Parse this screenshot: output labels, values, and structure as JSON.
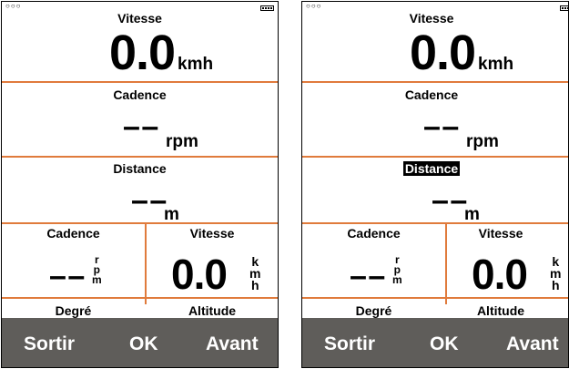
{
  "left": {
    "status": {
      "dots": "○○○"
    },
    "speed": {
      "label": "Vitesse",
      "value": "0.0",
      "unit": "kmh"
    },
    "cadence": {
      "label": "Cadence",
      "value": "– –",
      "unit": "rpm"
    },
    "distance": {
      "label": "Distance",
      "value": "– –",
      "unit": "m"
    },
    "grid": {
      "cadence": {
        "label": "Cadence",
        "value": "– –",
        "unit_letters": [
          "r",
          "p",
          "m"
        ]
      },
      "speed": {
        "label": "Vitesse",
        "value": "0.0",
        "unit_letters": [
          "k",
          "m",
          "h"
        ]
      },
      "degree_label": "Degré",
      "altitude_label": "Altitude"
    },
    "softkeys": {
      "left": "Sortir",
      "center": "OK",
      "right": "Avant"
    }
  },
  "right": {
    "status": {
      "dots": "○○○"
    },
    "speed": {
      "label": "Vitesse",
      "value": "0.0",
      "unit": "kmh"
    },
    "cadence": {
      "label": "Cadence",
      "value": "– –",
      "unit": "rpm"
    },
    "distance": {
      "label": "Distance",
      "value": "– –",
      "unit": "m",
      "selected": true
    },
    "grid": {
      "cadence": {
        "label": "Cadence",
        "value": "– –",
        "unit_letters": [
          "r",
          "p",
          "m"
        ]
      },
      "speed": {
        "label": "Vitesse",
        "value": "0.0",
        "unit_letters": [
          "k",
          "m",
          "h"
        ]
      },
      "degree_label": "Degré",
      "altitude_label": "Altitude"
    },
    "softkeys": {
      "left": "Sortir",
      "center": "OK",
      "right": "Avant"
    }
  },
  "colors": {
    "divider": "#e07b3c",
    "softkey_bar": "#5f5d5a",
    "highlight": "#000000"
  }
}
